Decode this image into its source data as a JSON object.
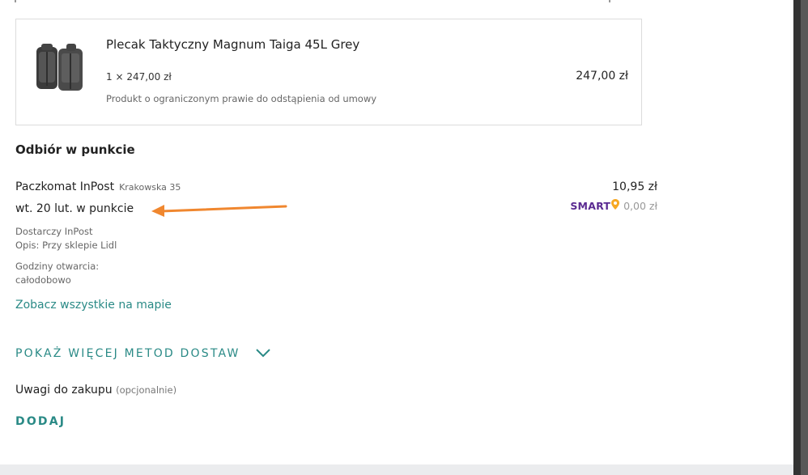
{
  "product": {
    "name": "Plecak Taktyczny Magnum Taiga 45L Grey",
    "quantity_price": "1 × 247,00 zł",
    "total": "247,00 zł",
    "note": "Produkt o ograniczonym prawie do odstąpienia od umowy",
    "image_icon": "backpack-image"
  },
  "delivery": {
    "section_title": "Odbiór w punkcie",
    "pickup_name": "Paczkomat InPost",
    "pickup_address": "Krakowska 35",
    "pickup_date": "wt. 20 lut. w punkcie",
    "price": "10,95 zł",
    "smart_logo": "SMART",
    "smart_price": "0,00 zł",
    "carrier": "Dostarczy InPost",
    "description": "Opis: Przy sklepie Lidl",
    "hours_label": "Godziny otwarcia:",
    "hours_value": "całodobowo",
    "map_link": "Zobacz wszystkie na mapie",
    "more_methods": "POKAŻ WIĘCEJ METOD DOSTAW"
  },
  "remarks": {
    "label": "Uwagi do zakupu",
    "optional": "(opcjonalnie)",
    "add_button": "DODAJ"
  },
  "colors": {
    "accent": "#2a8a86",
    "arrow": "#f0872f",
    "smart_purple": "#5a2a91",
    "smart_orange": "#f7a823"
  }
}
